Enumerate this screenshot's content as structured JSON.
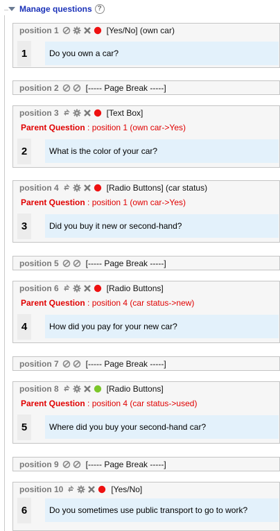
{
  "section": {
    "title": "Manage questions",
    "help_icon": "question-circle-icon"
  },
  "parent_label": "Parent Question",
  "items": [
    {
      "position": "position 1",
      "type": "[Yes/No] (own car)",
      "number": "1",
      "text": "Do you own a car?",
      "status": "red"
    },
    {
      "position": "position 2",
      "type": "[----- Page Break -----]"
    },
    {
      "position": "position 3",
      "type": "[Text Box]",
      "parent": ": position 1 (own car->Yes)",
      "number": "2",
      "text": "What is the color of your car?",
      "status": "red"
    },
    {
      "position": "position 4",
      "type": "[Radio Buttons] (car status)",
      "parent": ": position 1 (own car->Yes)",
      "number": "3",
      "text": "Did you buy it new or second-hand?",
      "status": "red"
    },
    {
      "position": "position 5",
      "type": "[----- Page Break -----]"
    },
    {
      "position": "position 6",
      "type": "[Radio Buttons]",
      "parent": ": position 4 (car status->new)",
      "number": "4",
      "text": "How did you pay for your new car?",
      "status": "red"
    },
    {
      "position": "position 7",
      "type": "[----- Page Break -----]"
    },
    {
      "position": "position 8",
      "type": "[Radio Buttons]",
      "parent": ": position 4 (car status->used)",
      "number": "5",
      "text": "Where did you buy your second-hand car?",
      "status": "green"
    },
    {
      "position": "position 9",
      "type": "[----- Page Break -----]"
    },
    {
      "position": "position 10",
      "type": "[Yes/No]",
      "number": "6",
      "text": "Do you sometimes use public transport to go to work?",
      "status": "red"
    }
  ],
  "colors": {
    "link_blue": "#1a31b8",
    "parent_red": "#e00000",
    "status_red": "#ee1111",
    "status_green": "#7cc62a",
    "question_bg": "#e3f1fb"
  }
}
